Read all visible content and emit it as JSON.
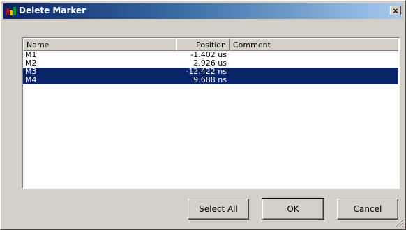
{
  "window": {
    "title": "Delete Marker",
    "close_label": "×",
    "icon_colors": [
      "#c00000",
      "#e8c000",
      "#00a000"
    ]
  },
  "list": {
    "columns": [
      {
        "key": "name",
        "label": "Name"
      },
      {
        "key": "position",
        "label": "Position"
      },
      {
        "key": "comment",
        "label": "Comment"
      }
    ],
    "rows": [
      {
        "name": "M1",
        "position": "-1.402 us",
        "comment": "",
        "selected": false
      },
      {
        "name": "M2",
        "position": "2.926 us",
        "comment": "",
        "selected": false
      },
      {
        "name": "M3",
        "position": "-12.422 ns",
        "comment": "",
        "selected": true
      },
      {
        "name": "M4",
        "position": "9.688 ns",
        "comment": "",
        "selected": true
      }
    ]
  },
  "buttons": {
    "select_all": "Select All",
    "ok": "OK",
    "cancel": "Cancel"
  },
  "colors": {
    "selection": "#0a246a",
    "title_gradient_start": "#0a246a",
    "title_gradient_end": "#a6caf0",
    "face": "#d4d0c8"
  }
}
